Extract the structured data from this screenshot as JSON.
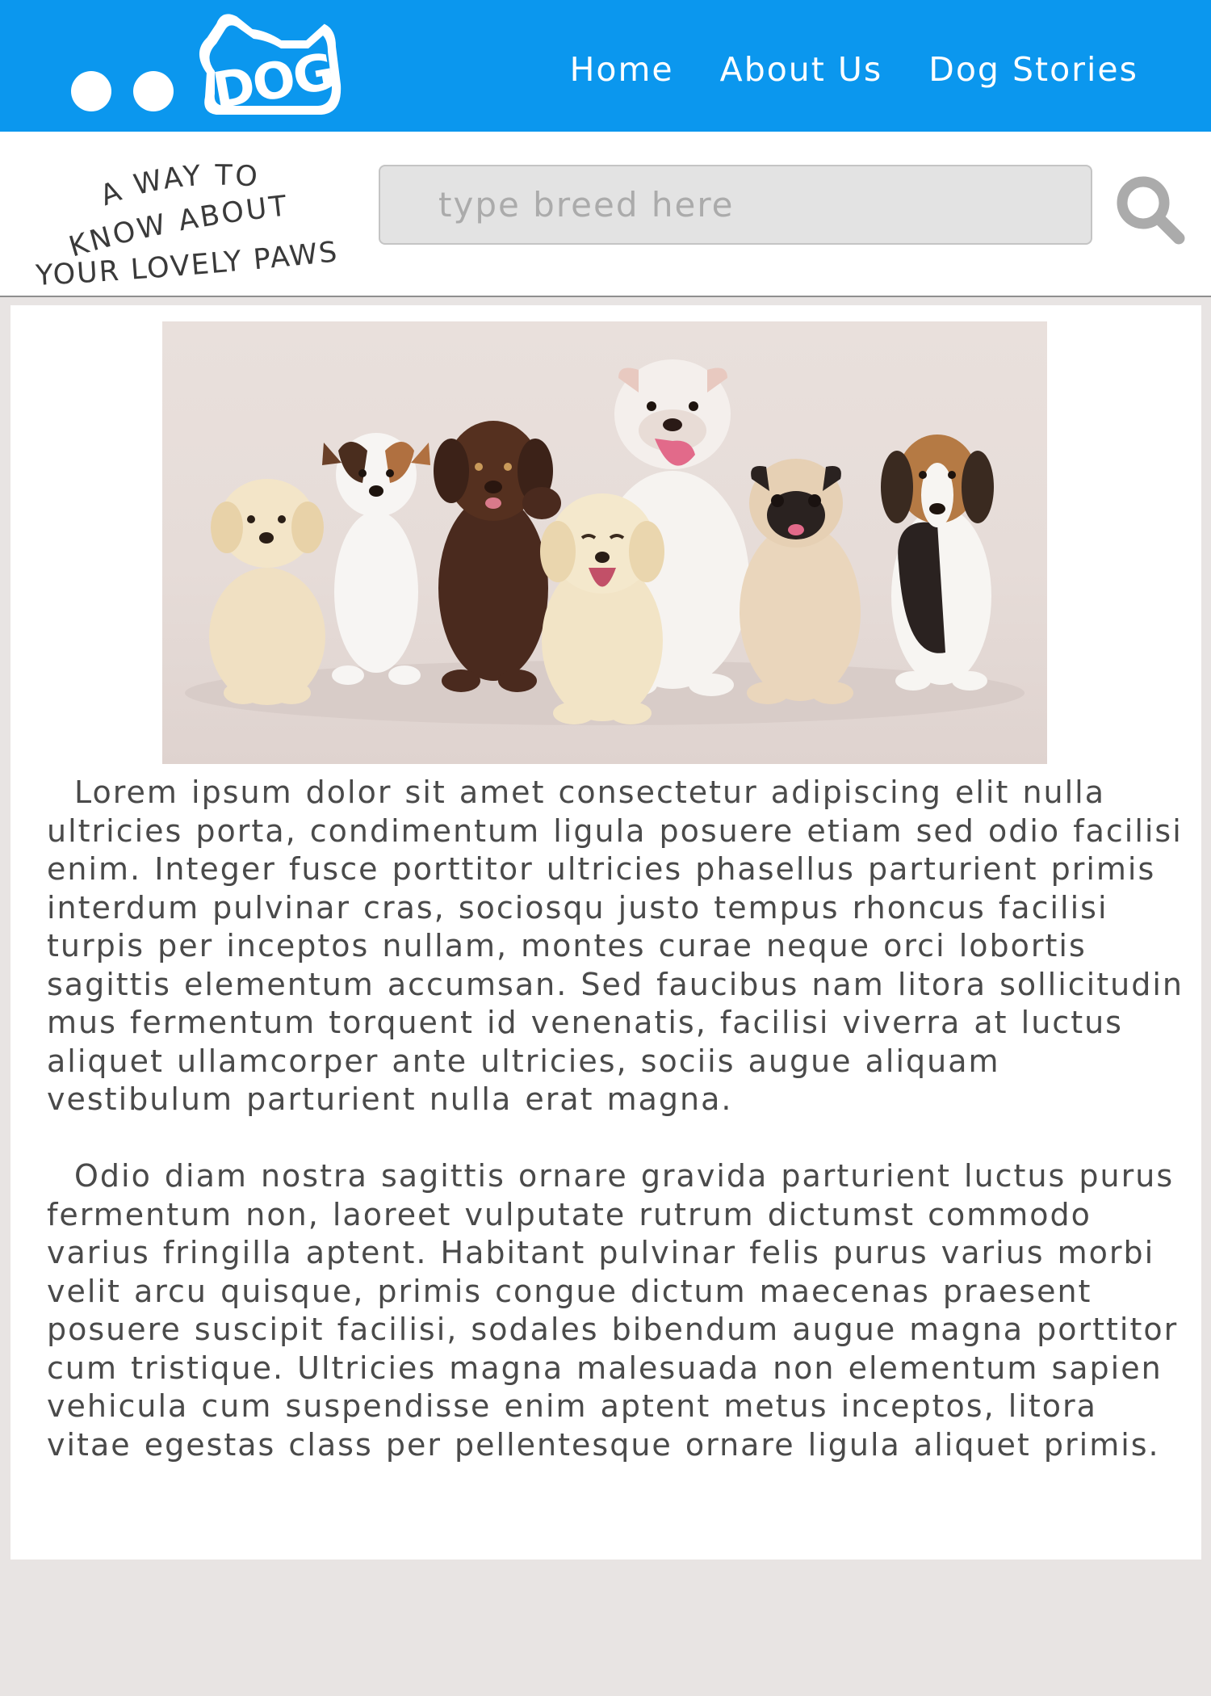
{
  "header": {
    "logo_text": "DOG",
    "bg_color": "#0b97ee",
    "nav": [
      {
        "label": "Home"
      },
      {
        "label": "About Us"
      },
      {
        "label": "Dog Stories"
      }
    ]
  },
  "tagline": {
    "line1": "A WAY TO",
    "line2": "KNOW ABOUT",
    "line3": "YOUR LOVELY PAWS"
  },
  "search": {
    "placeholder": "type breed here",
    "value": "",
    "icon": "search-icon"
  },
  "hero": {
    "icon": "puppies-photo"
  },
  "article": {
    "paragraphs": [
      "Lorem ipsum dolor sit amet consectetur adipiscing elit nulla ultricies porta, condimentum ligula posuere etiam sed odio facilisi enim. Integer fusce porttitor ultricies phasellus parturient primis interdum pulvinar cras, sociosqu justo tempus rhoncus facilisi turpis per inceptos nullam, montes curae neque orci lobortis sagittis elementum accumsan. Sed faucibus nam litora sollicitudin mus fermentum torquent id venenatis, facilisi viverra at luctus aliquet ullamcorper ante ultricies, sociis augue aliquam vestibulum parturient nulla erat magna.",
      "Odio diam nostra sagittis ornare gravida parturient luctus purus fermentum non, laoreet vulputate rutrum dictumst commodo varius fringilla aptent. Habitant pulvinar felis purus varius morbi velit arcu quisque, primis congue dictum maecenas praesent posuere suscipit facilisi, sodales bibendum augue magna porttitor cum tristique. Ultricies magna malesuada non elementum sapien vehicula cum suspendisse enim aptent metus inceptos, litora vitae egestas class per pellentesque ornare ligula aliquet primis."
    ]
  }
}
